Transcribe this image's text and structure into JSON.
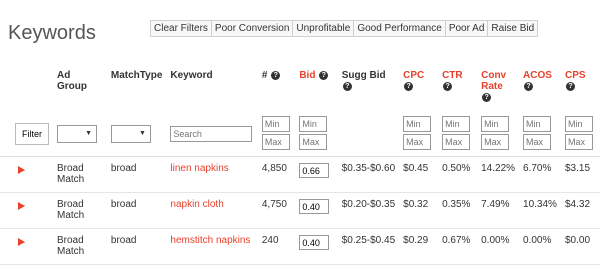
{
  "page": {
    "title": "Keywords"
  },
  "filters": [
    "Clear Filters",
    "Poor Conversion",
    "Unprofitable",
    "Good Performance",
    "Poor Ad",
    "Raise Bid"
  ],
  "columns": {
    "ad_group": "Ad Group",
    "match_type": "MatchType",
    "keyword": "Keyword",
    "num": "#",
    "bid": "Bid",
    "sugg_bid": "Sugg Bid",
    "cpc": "CPC",
    "ctr": "CTR",
    "conv_rate_1": "Conv",
    "conv_rate_2": "Rate",
    "acos": "ACOS",
    "cps": "CPS"
  },
  "filter_row": {
    "filter_button": "Filter",
    "search_placeholder": "Search",
    "min_placeholder": "Min",
    "max_placeholder": "Max"
  },
  "rows": [
    {
      "ad_group_1": "Broad",
      "ad_group_2": "Match",
      "match_type": "broad",
      "keyword": "linen napkins",
      "num": "4,850",
      "bid": "0.66",
      "sugg_bid": "$0.35-$0.60",
      "cpc": "$0.45",
      "ctr": "0.50%",
      "conv_rate": "14.22%",
      "acos": "6.70%",
      "cps": "$3.15"
    },
    {
      "ad_group_1": "Broad",
      "ad_group_2": "Match",
      "match_type": "broad",
      "keyword": "napkin cloth",
      "num": "4,750",
      "bid": "0.40",
      "sugg_bid": "$0.20-$0.35",
      "cpc": "$0.32",
      "ctr": "0.35%",
      "conv_rate": "7.49%",
      "acos": "10.34%",
      "cps": "$4.32"
    },
    {
      "ad_group_1": "Broad",
      "ad_group_2": "Match",
      "match_type": "broad",
      "keyword": "hemstitch napkins",
      "num": "240",
      "bid": "0.40",
      "sugg_bid": "$0.25-$0.45",
      "cpc": "$0.29",
      "ctr": "0.67%",
      "conv_rate": "0.00%",
      "acos": "0.00%",
      "cps": "$0.00"
    }
  ],
  "colors": {
    "accent": "#e8412c",
    "text": "#333333"
  }
}
